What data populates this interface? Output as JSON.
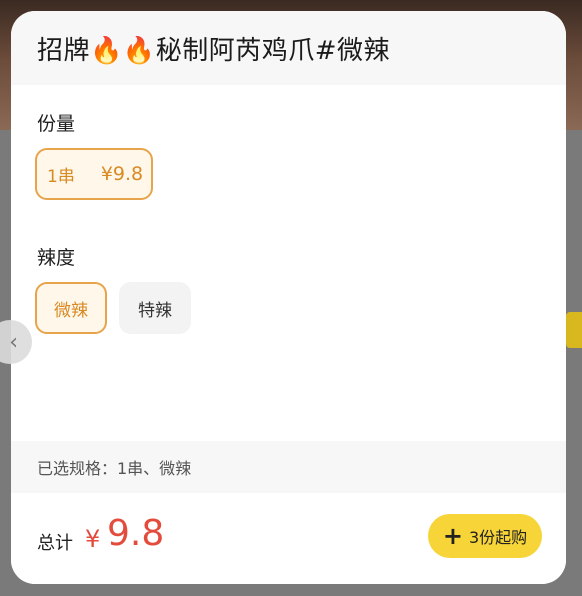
{
  "product": {
    "title": "招牌🔥🔥秘制阿芮鸡爪#微辣"
  },
  "sections": {
    "portion": {
      "label": "份量",
      "options": [
        {
          "name": "1串",
          "price": "¥9.8",
          "selected": true
        }
      ]
    },
    "spice": {
      "label": "辣度",
      "options": [
        {
          "name": "微辣",
          "selected": true
        },
        {
          "name": "特辣",
          "selected": false
        }
      ]
    }
  },
  "summary": {
    "text": "已选规格：1串、微辣"
  },
  "footer": {
    "total_label": "总计",
    "currency": "¥",
    "amount": "9.8",
    "buy_label": "3份起购"
  },
  "icons": {
    "plus": "plus-icon",
    "side_arrow": "chevron-left-icon"
  },
  "colors": {
    "accent": "#e7a44a",
    "price": "#e34b3c",
    "button": "#f7d437"
  }
}
